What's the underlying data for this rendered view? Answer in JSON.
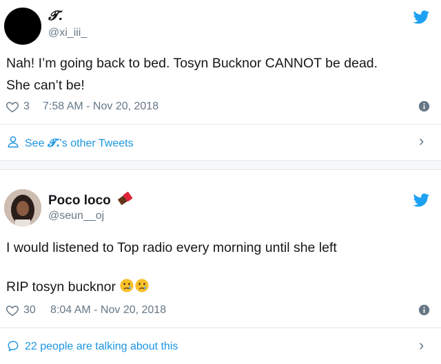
{
  "tweets": [
    {
      "display_name": "𝓣.",
      "handle": "@xi_iii_",
      "text_lines": [
        "Nah! I’m going back to bed. Tosyn Bucknor CANNOT be dead.",
        "She can’t be!"
      ],
      "likes": "3",
      "timestamp": "7:58 AM - Nov 20, 2018",
      "footer_prefix": "See ",
      "footer_name": "𝓣.",
      "footer_suffix": "'s other Tweets"
    },
    {
      "display_name": "Poco loco",
      "handle": "@seun__oj",
      "text_line1": "I would listened to Top radio every morning until she left",
      "text_line2": "RIP tosyn bucknor",
      "likes": "30",
      "timestamp": "8:04 AM - Nov 20, 2018",
      "footer_text": "22 people are talking about this"
    }
  ],
  "icons": {
    "brand": "twitter-bird",
    "like": "heart-outline",
    "info": "info-circle",
    "profile": "person-outline",
    "conversation": "speech-bubble",
    "chevron": "chevron-right",
    "emoji_name": "chocolate-bar",
    "emoji_text": "crying-face"
  },
  "colors": {
    "twitter_blue": "#1da1f2",
    "link_blue": "#1b95e0",
    "secondary_text": "#657786",
    "divider": "#e1e8ed"
  }
}
